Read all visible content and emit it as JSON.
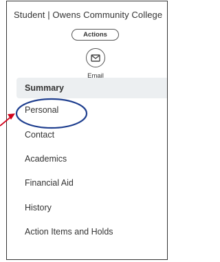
{
  "header": {
    "title": "Student | Owens Community College"
  },
  "actions": {
    "label": "Actions"
  },
  "email": {
    "label": "Email",
    "icon": "envelope-icon"
  },
  "nav": {
    "items": [
      {
        "label": "Summary",
        "selected": true
      },
      {
        "label": "Personal"
      },
      {
        "label": "Contact"
      },
      {
        "label": "Academics"
      },
      {
        "label": "Financial Aid"
      },
      {
        "label": "History"
      },
      {
        "label": "Action Items and Holds"
      }
    ]
  },
  "annotation": {
    "color": "#d0021b",
    "highlight_color": "#1f3f8f"
  }
}
